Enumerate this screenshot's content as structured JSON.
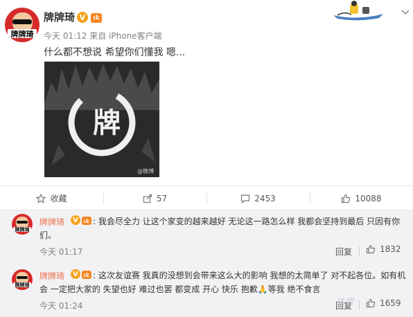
{
  "post": {
    "author": "牌牌琦",
    "v_badge": "V",
    "level_badge": "ιĿ",
    "time_source": "今天 01:12 来自 iPhone客户端",
    "text": "什么都不想说 希望你们懂我 嗯...",
    "image_glyph": "牌",
    "image_watermark": "@微博"
  },
  "actions": {
    "favorite": "收藏",
    "share_count": "57",
    "comment_count": "2453",
    "like_count": "10088"
  },
  "comments": [
    {
      "author": "牌牌琦",
      "text": ": 我会尽全力 让这个家变的越来越好 无论这一路怎么样 我都会坚持到最后 只因有你们。",
      "time": "今天 01:17",
      "reply": "回复",
      "likes": "1832"
    },
    {
      "author": "牌牌琦",
      "text": ": 这次友谊赛 我真的没想到会带来这么大的影响 我想的太简单了 对不起各位。如有机会 一定把大家的 失望也好 难过也罢 都变成 开心 快乐 抱歉🙏等我 绝不食言",
      "time": "今天 01:24",
      "reply": "回复",
      "likes": "1659"
    }
  ],
  "avatar_label": "牌牌琦",
  "watermark": "体育",
  "colors": {
    "name_orange": "#eb7350",
    "badge_orange": "#f7a21b",
    "avatar_red": "#d62a2a",
    "meta_gray": "#808080"
  },
  "icons": [
    "star-icon",
    "share-icon",
    "comment-icon",
    "thumbs-up-icon",
    "chevron-down-icon"
  ]
}
